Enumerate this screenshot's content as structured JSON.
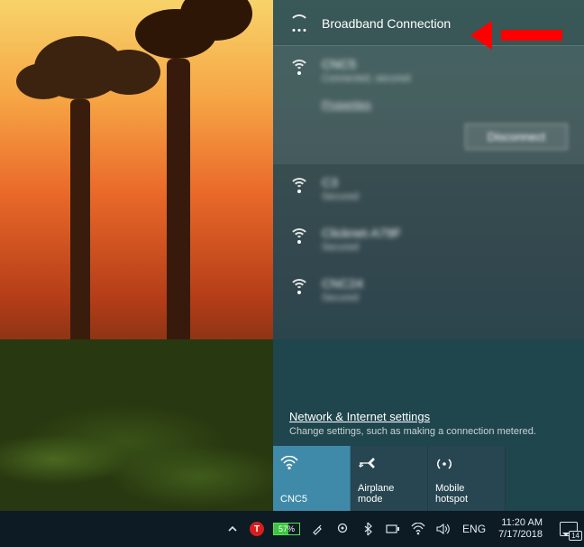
{
  "flyout": {
    "broadband": {
      "label": "Broadband Connection"
    },
    "networks": [
      {
        "name": "CNC5",
        "status": "Connected, secured",
        "properties_label": "Properties",
        "disconnect_label": "Disconnect",
        "expanded": true
      },
      {
        "name": "C3",
        "status": "Secured"
      },
      {
        "name": "Clicknet-A79F",
        "status": "Secured"
      },
      {
        "name": "CNC24",
        "status": "Secured"
      }
    ],
    "settings": {
      "link": "Network & Internet settings",
      "sub": "Change settings, such as making a connection metered."
    },
    "tiles": {
      "wifi": "CNC5",
      "airplane": "Airplane mode",
      "hotspot": "Mobile hotspot"
    }
  },
  "taskbar": {
    "battery": "57%",
    "lang": "ENG",
    "time": "11:20 AM",
    "date": "7/17/2018",
    "action_center_count": "14"
  }
}
